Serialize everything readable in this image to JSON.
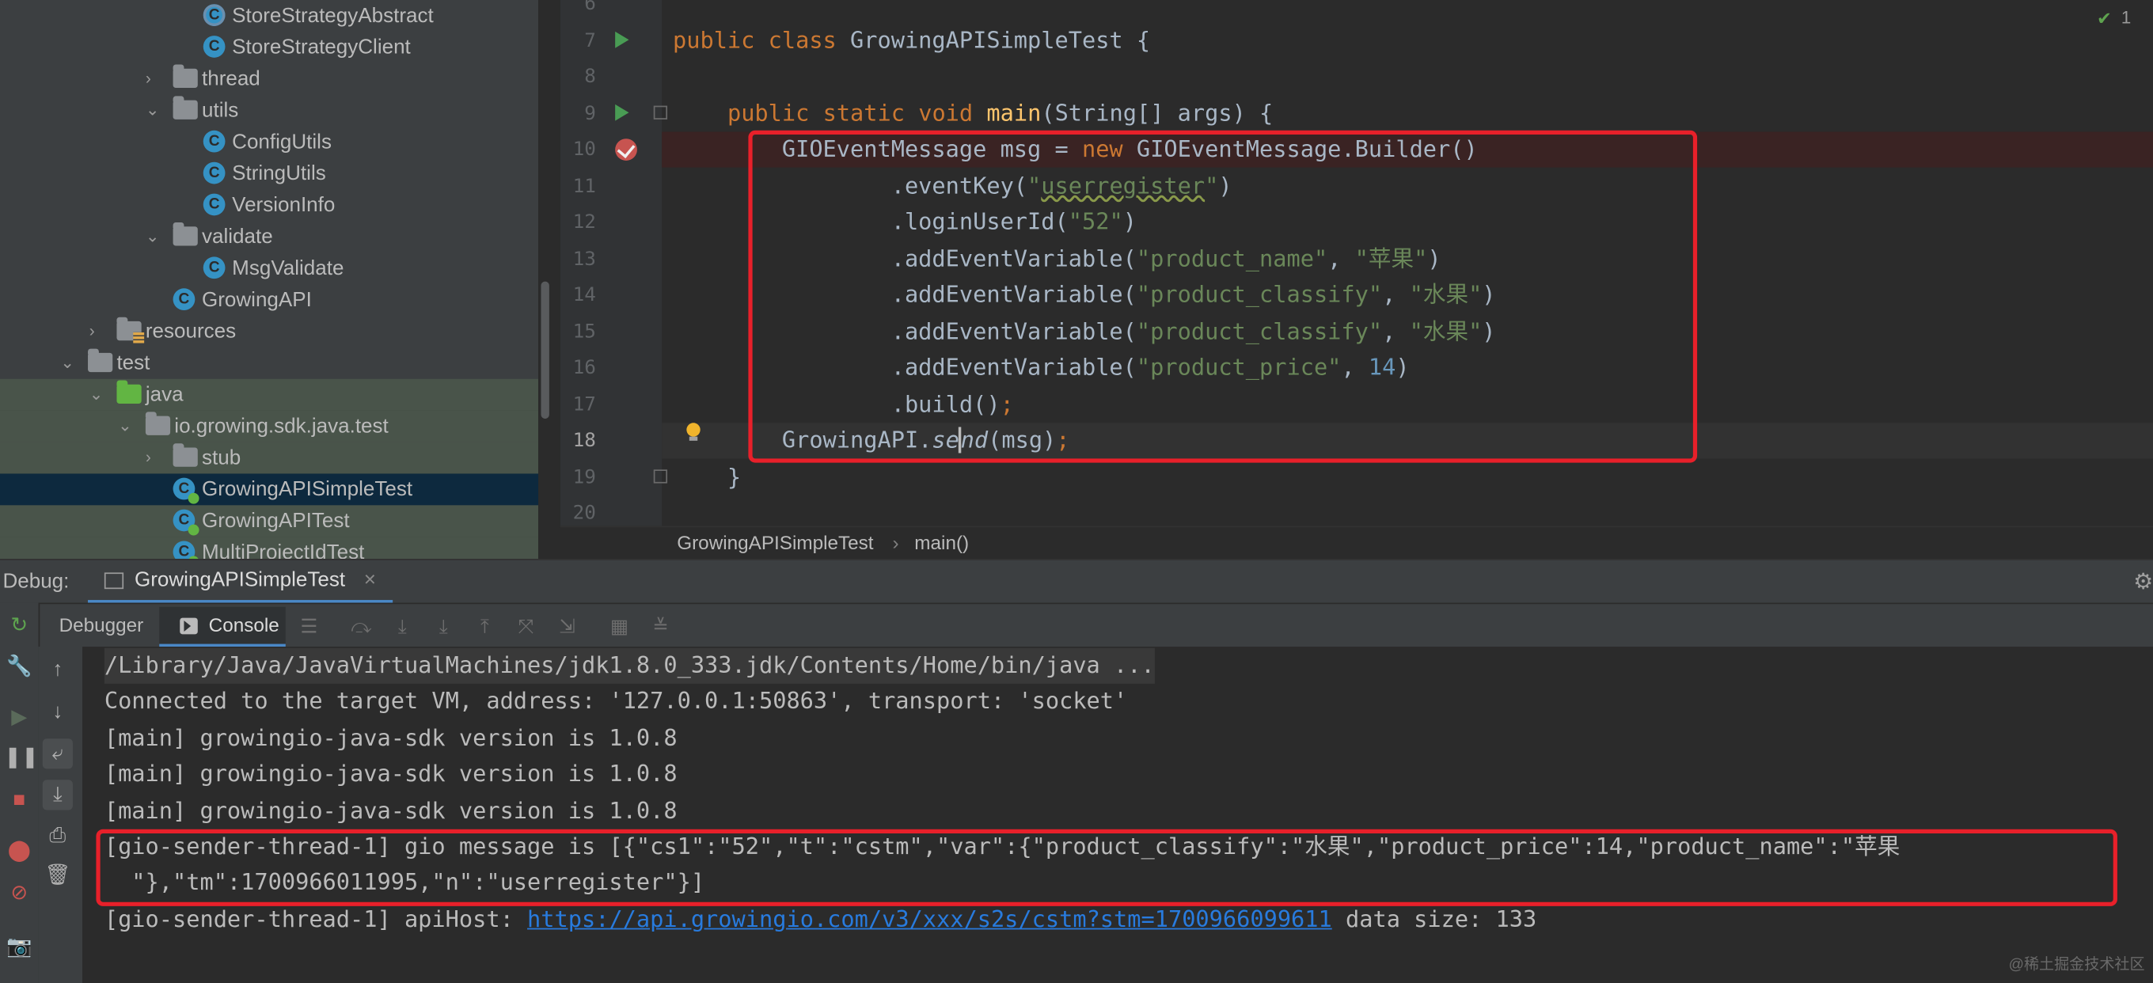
{
  "tree": [
    {
      "label": "StoreStrategyAbstract",
      "indent": 148,
      "icon": "abs",
      "chev": ""
    },
    {
      "label": "StoreStrategyClient",
      "indent": 148,
      "icon": "class",
      "chev": ""
    },
    {
      "label": "thread",
      "indent": 126,
      "icon": "folder",
      "chev": "›"
    },
    {
      "label": "utils",
      "indent": 126,
      "icon": "folder",
      "chev": "⌄"
    },
    {
      "label": "ConfigUtils",
      "indent": 148,
      "icon": "class",
      "chev": ""
    },
    {
      "label": "StringUtils",
      "indent": 148,
      "icon": "class",
      "chev": ""
    },
    {
      "label": "VersionInfo",
      "indent": 148,
      "icon": "class",
      "chev": ""
    },
    {
      "label": "validate",
      "indent": 126,
      "icon": "folder",
      "chev": "⌄"
    },
    {
      "label": "MsgValidate",
      "indent": 148,
      "icon": "class",
      "chev": ""
    },
    {
      "label": "GrowingAPI",
      "indent": 126,
      "icon": "class",
      "chev": ""
    },
    {
      "label": "resources",
      "indent": 85,
      "icon": "res",
      "chev": "›"
    },
    {
      "label": "test",
      "indent": 64,
      "icon": "folder",
      "chev": "⌄"
    },
    {
      "label": "java",
      "indent": 85,
      "icon": "greenfolder",
      "chev": "⌄",
      "green": true
    },
    {
      "label": "io.growing.sdk.java.test",
      "indent": 106,
      "icon": "folder",
      "chev": "⌄",
      "green": true
    },
    {
      "label": "stub",
      "indent": 126,
      "icon": "folder",
      "chev": "›",
      "green": true
    },
    {
      "label": "GrowingAPISimpleTest",
      "indent": 126,
      "icon": "test",
      "chev": "",
      "sel": true
    },
    {
      "label": "GrowingAPITest",
      "indent": 126,
      "icon": "test",
      "chev": "",
      "green": true
    },
    {
      "label": "MultiProjectIdTest",
      "indent": 126,
      "icon": "test",
      "chev": "",
      "green": true
    }
  ],
  "editor": {
    "line_numbers": [
      "6",
      "7",
      "8",
      "9",
      "10",
      "11",
      "12",
      "13",
      "14",
      "15",
      "16",
      "17",
      "18",
      "19",
      "20"
    ],
    "inspection_count": "1",
    "code": [
      [],
      [
        [
          "kw",
          "public class "
        ],
        [
          "",
          "GrowingAPISimpleTest {"
        ]
      ],
      [],
      [
        [
          "",
          "    "
        ],
        [
          "kw",
          "public static void "
        ],
        [
          "fn",
          "main"
        ],
        [
          "",
          "(String[] args) {"
        ]
      ],
      [
        [
          "",
          "        GIOEventMessage msg = "
        ],
        [
          "kw",
          "new "
        ],
        [
          "",
          "GIOEventMessage.Builder()"
        ]
      ],
      [
        [
          "",
          "                .eventKey("
        ],
        [
          "str",
          "\""
        ],
        [
          "strw",
          "userregister"
        ],
        [
          "str",
          "\""
        ],
        [
          "",
          ")"
        ]
      ],
      [
        [
          "",
          "                .loginUserId("
        ],
        [
          "str",
          "\"52\""
        ],
        [
          "",
          ")"
        ]
      ],
      [
        [
          "",
          "                .addEventVariable("
        ],
        [
          "str",
          "\"product_name\""
        ],
        [
          "",
          ", "
        ],
        [
          "str",
          "\"苹果\""
        ],
        [
          "",
          ")"
        ]
      ],
      [
        [
          "",
          "                .addEventVariable("
        ],
        [
          "str",
          "\"product_classify\""
        ],
        [
          "",
          ", "
        ],
        [
          "str",
          "\"水果\""
        ],
        [
          "",
          ")"
        ]
      ],
      [
        [
          "",
          "                .addEventVariable("
        ],
        [
          "str",
          "\"product_classify\""
        ],
        [
          "",
          ", "
        ],
        [
          "str",
          "\"水果\""
        ],
        [
          "",
          ")"
        ]
      ],
      [
        [
          "",
          "                .addEventVariable("
        ],
        [
          "str",
          "\"product_price\""
        ],
        [
          "",
          ", "
        ],
        [
          "num",
          "14"
        ],
        [
          "",
          ")"
        ]
      ],
      [
        [
          "",
          "                .build()"
        ],
        [
          "kw",
          ";"
        ]
      ],
      [
        [
          "",
          "        GrowingAPI."
        ],
        [
          "it",
          "se"
        ],
        [
          "caret",
          ""
        ],
        [
          "it",
          "nd"
        ],
        [
          "",
          "(msg)"
        ],
        [
          "kw",
          ";"
        ]
      ],
      [
        [
          "",
          "    }"
        ]
      ],
      []
    ]
  },
  "breadcrumb": {
    "class_name": "GrowingAPISimpleTest",
    "sep": "›",
    "method": "main()"
  },
  "debug": {
    "label": "Debug:",
    "tab": "GrowingAPISimpleTest",
    "tab_close": "×",
    "debugger_tab": "Debugger",
    "console_tab": "Console"
  },
  "console": {
    "lines": [
      "/Library/Java/JavaVirtualMachines/jdk1.8.0_333.jdk/Contents/Home/bin/java ...",
      "Connected to the target VM, address: '127.0.0.1:50863', transport: 'socket'",
      "[main] growingio-java-sdk version is 1.0.8",
      "[main] growingio-java-sdk version is 1.0.8",
      "[main] growingio-java-sdk version is 1.0.8",
      "[gio-sender-thread-1] gio message is [{\"cs1\":\"52\",\"t\":\"cstm\",\"var\":{\"product_classify\":\"水果\",\"product_price\":14,\"product_name\":\"苹果",
      "  \"},\"tm\":1700966011995,\"n\":\"userregister\"}]"
    ],
    "api_prefix": "[gio-sender-thread-1] apiHost: ",
    "api_url": "https://api.growingio.com/v3/xxx/s2s/cstm?stm=1700966099611",
    "api_suffix": " data size: 133"
  },
  "watermark": "@稀土掘金技术社区"
}
